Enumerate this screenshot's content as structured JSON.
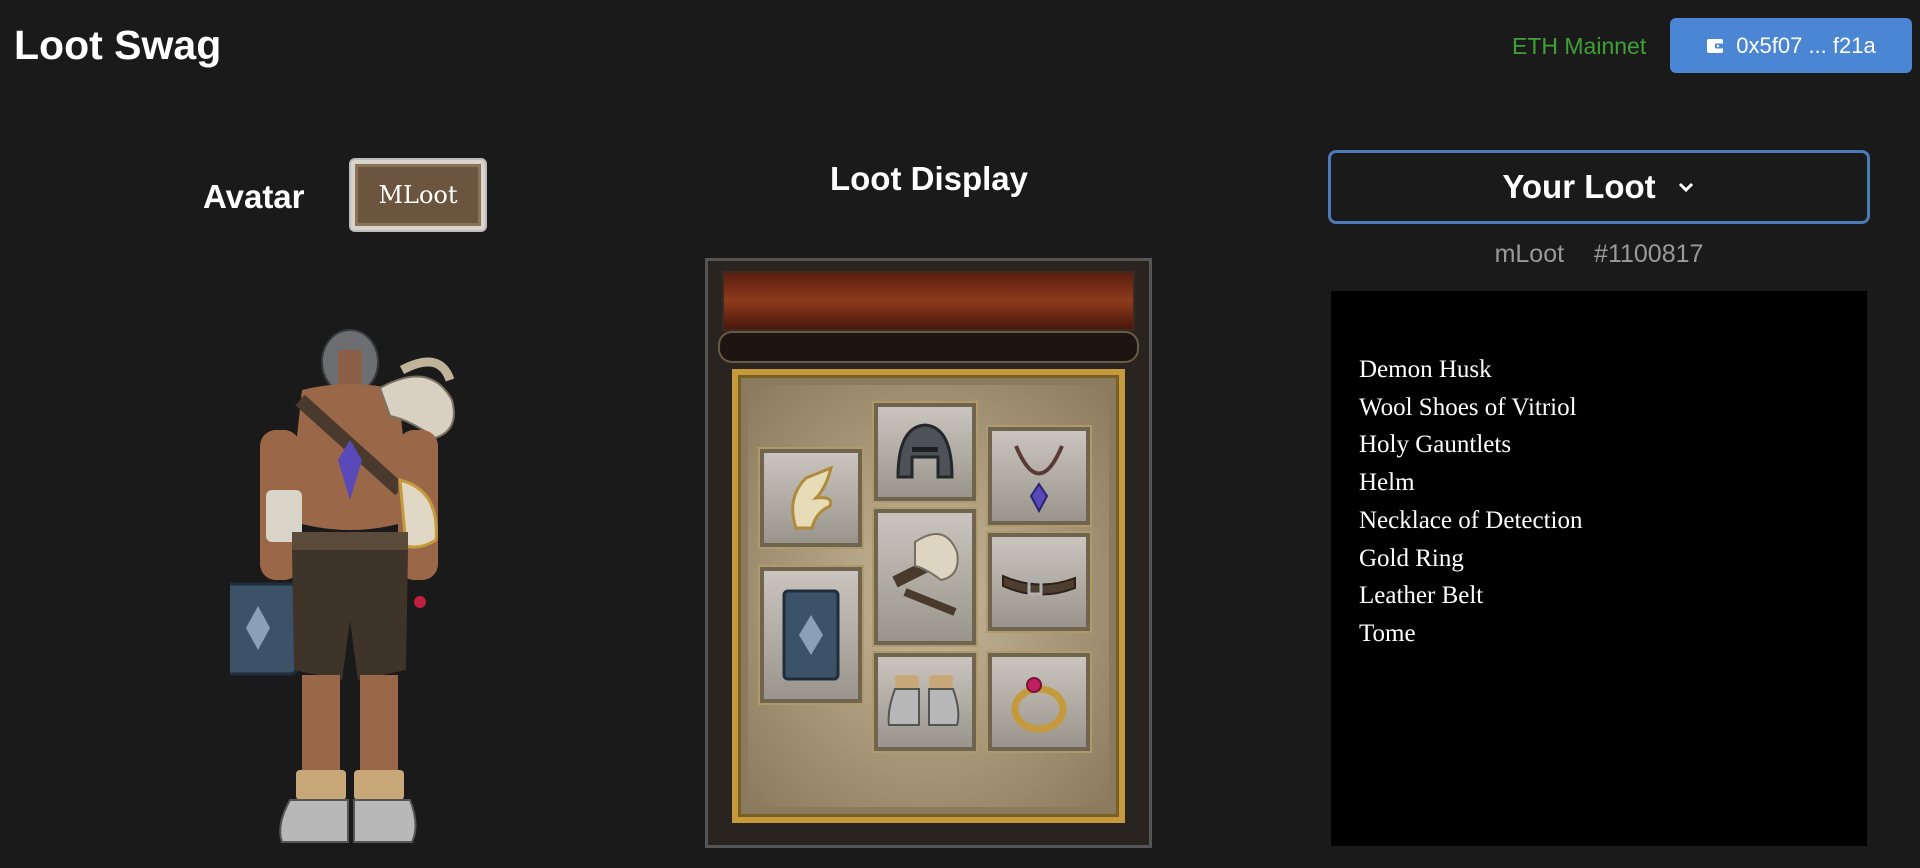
{
  "header": {
    "app_title": "Loot Swag",
    "network": "ETH Mainnet",
    "wallet_address": "0x5f07 ... f21a",
    "wallet_icon": "wallet-icon"
  },
  "avatar_section": {
    "heading": "Avatar",
    "badge_label": "MLoot"
  },
  "display_section": {
    "heading": "Loot Display",
    "slot_icons": [
      "gauntlet-icon",
      "helm-icon",
      "necklace-icon",
      "demon-husk-icon",
      "belt-icon",
      "tome-icon",
      "shoes-icon",
      "ring-icon"
    ]
  },
  "loot_section": {
    "select_label": "Your Loot",
    "collection": "mLoot",
    "token_id": "#1100817",
    "items": [
      "Demon Husk",
      "Wool Shoes of Vitriol",
      "Holy Gauntlets",
      "Helm",
      "Necklace of Detection",
      "Gold Ring",
      "Leather Belt",
      "Tome"
    ]
  },
  "colors": {
    "background": "#1a1a1a",
    "network_green": "#3fa035",
    "wallet_blue": "#4a86d4",
    "select_border": "#4a7ab8"
  }
}
